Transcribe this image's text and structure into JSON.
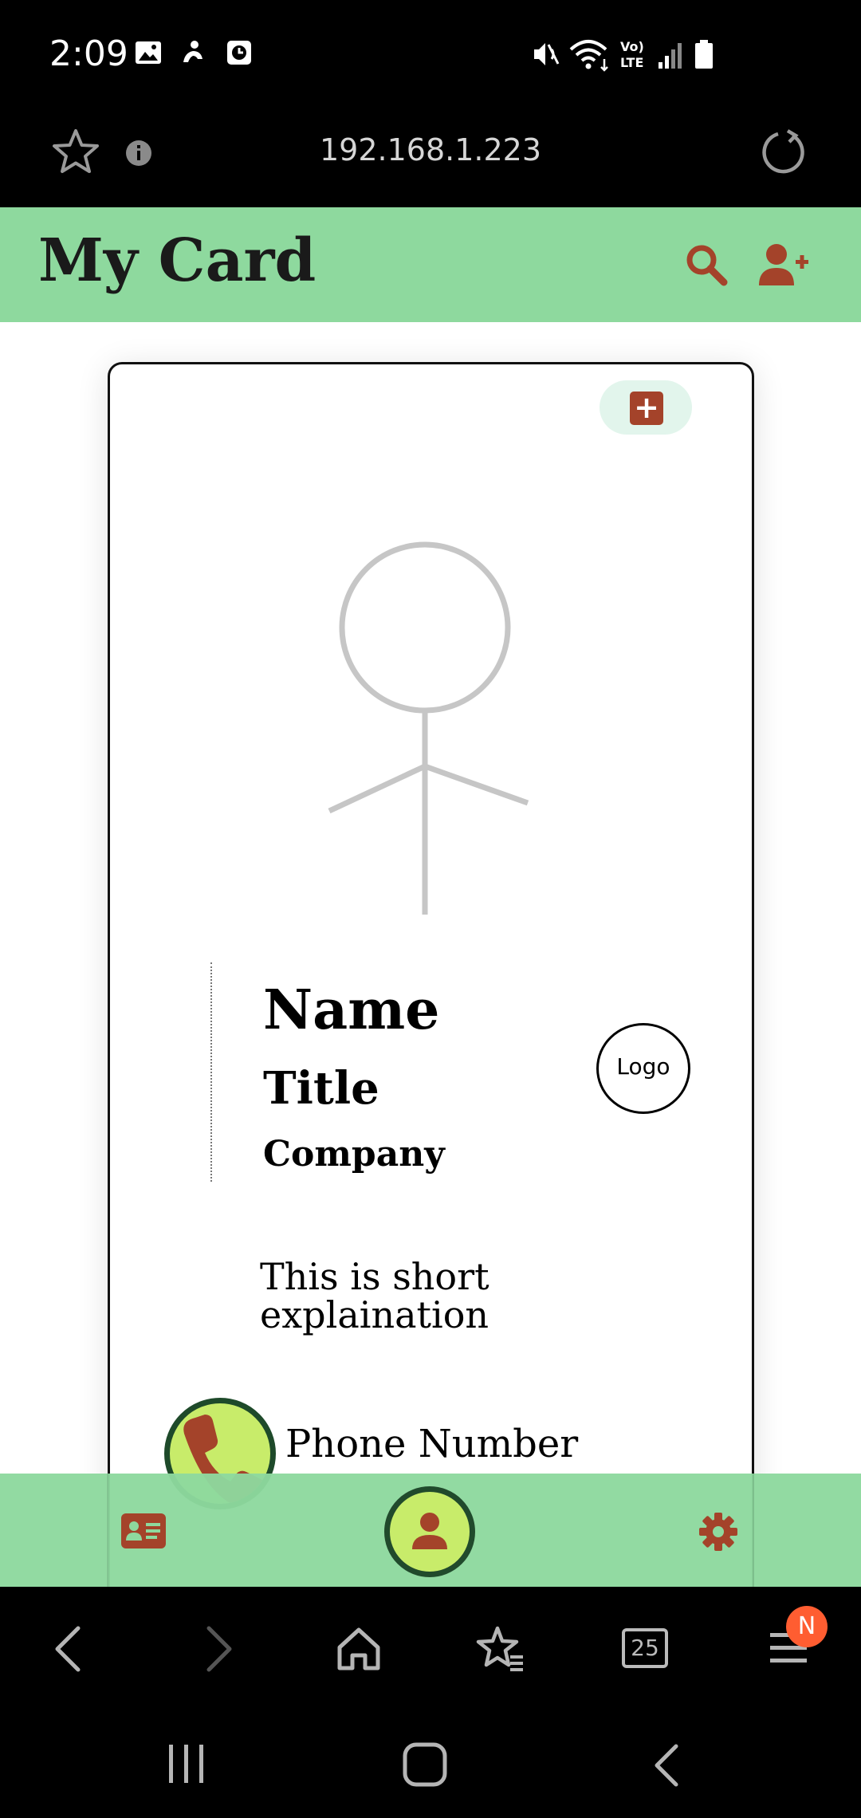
{
  "status_bar": {
    "time": "2:09",
    "icons": [
      "image-icon",
      "notification-icon",
      "clock-app-icon",
      "mute-icon",
      "wifi-icon",
      "volte-icon",
      "signal-icon",
      "battery-icon"
    ]
  },
  "browser": {
    "url": "192.168.1.223",
    "icons": [
      "star-icon",
      "info-icon",
      "reload-icon"
    ]
  },
  "app": {
    "header": {
      "title": "My Card",
      "icons": [
        "search-icon",
        "add-user-icon"
      ]
    },
    "card": {
      "name": "Name",
      "title": "Title",
      "company": "Company",
      "logo": "Logo",
      "description": "This is short explaination",
      "phone": "Phone Number",
      "add_button_symbol": "+"
    },
    "bottom_nav": {
      "icons": [
        "contact-card-icon",
        "profile-icon",
        "settings-icon"
      ]
    }
  },
  "browser_toolbar": {
    "tab_count": "25",
    "notification_badge": "N",
    "icons": [
      "back-icon",
      "forward-icon",
      "home-icon",
      "bookmarks-icon",
      "tabs-icon",
      "menu-icon"
    ]
  },
  "system_nav": {
    "icons": [
      "recent-apps-icon",
      "home-button-icon",
      "system-back-icon"
    ]
  },
  "colors": {
    "header_green": "#8ed99e",
    "accent_rust": "#a4432a",
    "lime": "#c8ec6a",
    "dark_green": "#1e4a2a",
    "pill_mint": "#e2f5ec",
    "badge_orange": "#ff5d31"
  }
}
